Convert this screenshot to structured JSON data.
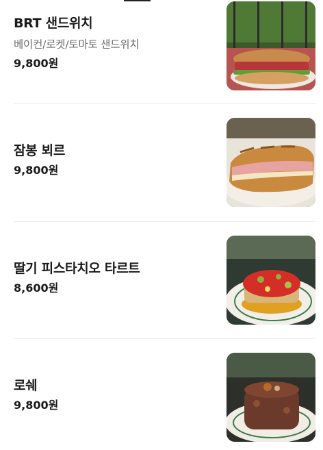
{
  "menu": {
    "items": [
      {
        "name": "BRT 샌드위치",
        "description": "베이컨/로켓/토마토 샌드위치",
        "price": "9,800원",
        "image": "bacon-rocket-tomato-sandwich-photo"
      },
      {
        "name": "잠봉 뵈르",
        "description": "",
        "price": "9,800원",
        "image": "jambon-beurre-baguette-photo"
      },
      {
        "name": "딸기 피스타치오 타르트",
        "description": "",
        "price": "8,600원",
        "image": "strawberry-pistachio-tart-photo"
      },
      {
        "name": "로쉐",
        "description": "",
        "price": "9,800원",
        "image": "rocher-chocolate-cake-photo"
      }
    ]
  }
}
